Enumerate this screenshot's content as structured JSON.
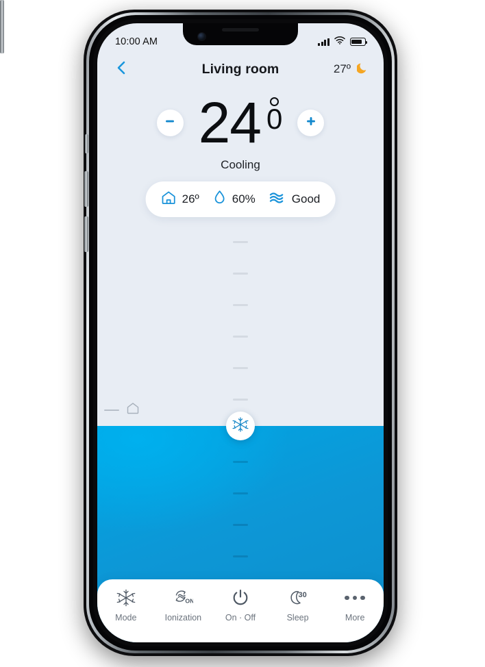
{
  "status_bar": {
    "time": "10:00 AM",
    "signal_icon": "cellular-signal-icon",
    "wifi_icon": "wifi-icon",
    "battery_icon": "battery-icon"
  },
  "header": {
    "back_icon": "chevron-left-icon",
    "title": "Living room",
    "outdoor_temp": "27º",
    "weather_icon": "crescent-moon-icon"
  },
  "thermostat": {
    "decrease_icon": "minus-icon",
    "increase_icon": "plus-icon",
    "target_temp_integer": "24",
    "target_temp_decimal": "0",
    "degree_symbol": "º",
    "mode_label": "Cooling"
  },
  "info_pill": {
    "items": [
      {
        "icon": "house-icon",
        "value": "26º"
      },
      {
        "icon": "droplet-icon",
        "value": "60%"
      },
      {
        "icon": "air-waves-icon",
        "value": "Good"
      }
    ]
  },
  "slider": {
    "handle_icon": "snowflake-icon",
    "ambient_marker_icon": "house-outline-icon",
    "fill_color": "#0d97d6",
    "track_tick_color": "#d4dae2"
  },
  "bottom_nav": {
    "items": [
      {
        "icon": "snowflake-icon",
        "label": "Mode"
      },
      {
        "icon": "ionization-icon",
        "label": "Ionization"
      },
      {
        "icon": "power-icon",
        "label": "On · Off"
      },
      {
        "icon": "moon-timer-icon",
        "label": "Sleep",
        "badge": "30"
      },
      {
        "icon": "ellipsis-icon",
        "label": "More"
      }
    ]
  },
  "theme": {
    "accent": "#0a8fd0",
    "screen_bg": "#e8edf4",
    "nav_label_color": "#6b737d"
  }
}
